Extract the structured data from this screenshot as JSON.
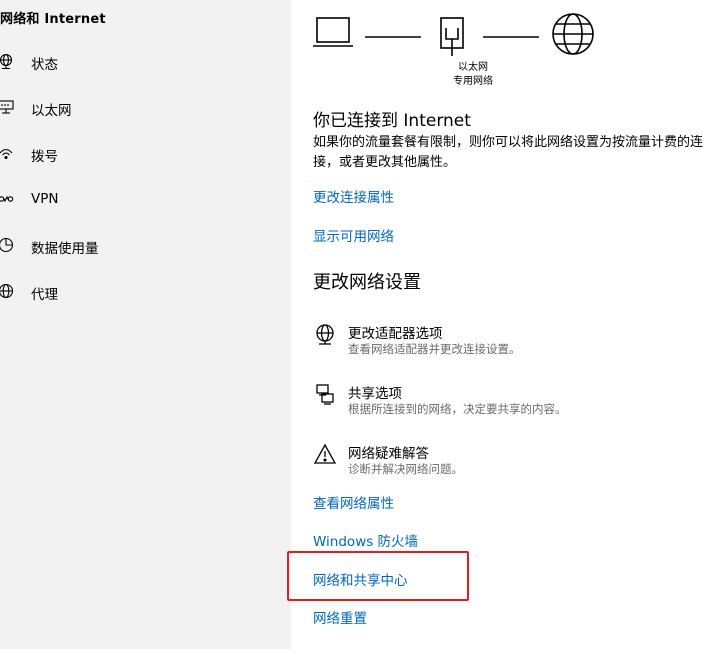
{
  "sidebar": {
    "title": "网络和 Internet",
    "items": [
      {
        "label": "状态",
        "icon": "globe-status-icon"
      },
      {
        "label": "以太网",
        "icon": "ethernet-icon"
      },
      {
        "label": "拨号",
        "icon": "dialup-icon"
      },
      {
        "label": "VPN",
        "icon": "vpn-icon"
      },
      {
        "label": "数据使用量",
        "icon": "data-usage-icon"
      },
      {
        "label": "代理",
        "icon": "proxy-globe-icon"
      }
    ]
  },
  "diagram": {
    "caption_line1": "以太网",
    "caption_line2": "专用网络",
    "icons": [
      "laptop-icon",
      "ethernet-port-icon",
      "globe-internet-icon"
    ]
  },
  "status": {
    "title": "你已连接到 Internet",
    "description": "如果你的流量套餐有限制，则你可以将此网络设置为按流量计费的连接，或者更改其他属性。"
  },
  "links": {
    "change_connection": "更改连接属性",
    "show_networks": "显示可用网络",
    "view_properties": "查看网络属性",
    "firewall": "Windows 防火墙",
    "sharing_center": "网络和共享中心",
    "reset": "网络重置"
  },
  "section": {
    "title": "更改网络设置"
  },
  "options": [
    {
      "title": "更改适配器选项",
      "desc": "查看网络适配器并更改连接设置。",
      "icon": "adapter-globe-icon"
    },
    {
      "title": "共享选项",
      "desc": "根据所连接到的网络，决定要共享的内容。",
      "icon": "sharing-icon"
    },
    {
      "title": "网络疑难解答",
      "desc": "诊断并解决网络问题。",
      "icon": "warning-icon"
    }
  ],
  "colors": {
    "link": "#0067c0",
    "sidebar_bg": "#f2f2f2",
    "highlight": "#e02020"
  }
}
